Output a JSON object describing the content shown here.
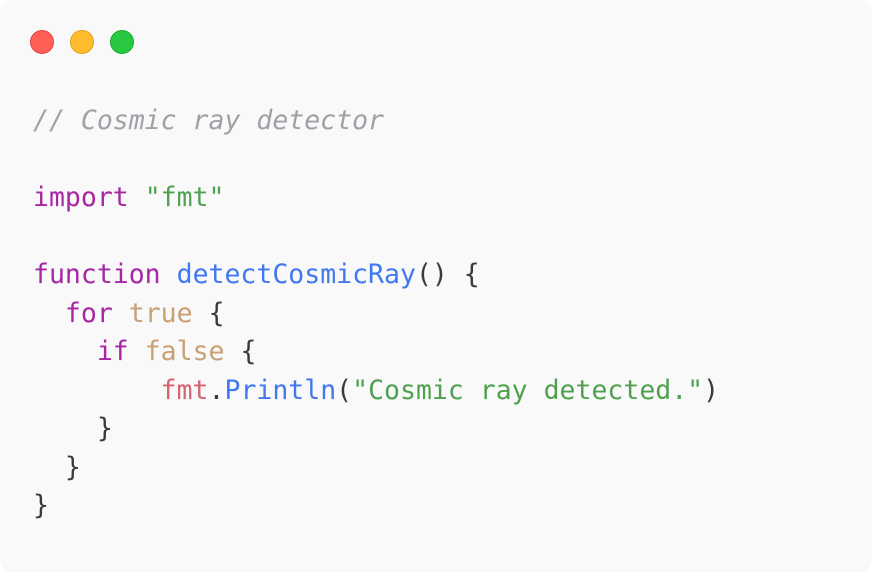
{
  "window": {
    "buttons": [
      "close",
      "minimize",
      "zoom"
    ]
  },
  "code": {
    "comment": "// Cosmic ray detector",
    "import_kw": "import",
    "import_str": "\"fmt\"",
    "func_kw": "function",
    "func_name": "detectCosmicRay",
    "func_open": "() {",
    "for_kw": "for",
    "for_cond": "true",
    "brace_open": "{",
    "if_kw": "if",
    "if_cond": "false",
    "pkg": "fmt",
    "dot": ".",
    "method": "Println",
    "paren_open": "(",
    "message": "\"Cosmic ray detected.\"",
    "paren_close": ")",
    "brace_close": "}"
  },
  "colors": {
    "comment": "#a0a1a7",
    "keyword": "#a626a4",
    "string": "#50a14f",
    "function": "#4078f2",
    "boolean": "#c8a074",
    "package": "#d66470",
    "close_button": "#ff5f57",
    "minimize_button": "#febc2e",
    "zoom_button": "#28c840"
  }
}
